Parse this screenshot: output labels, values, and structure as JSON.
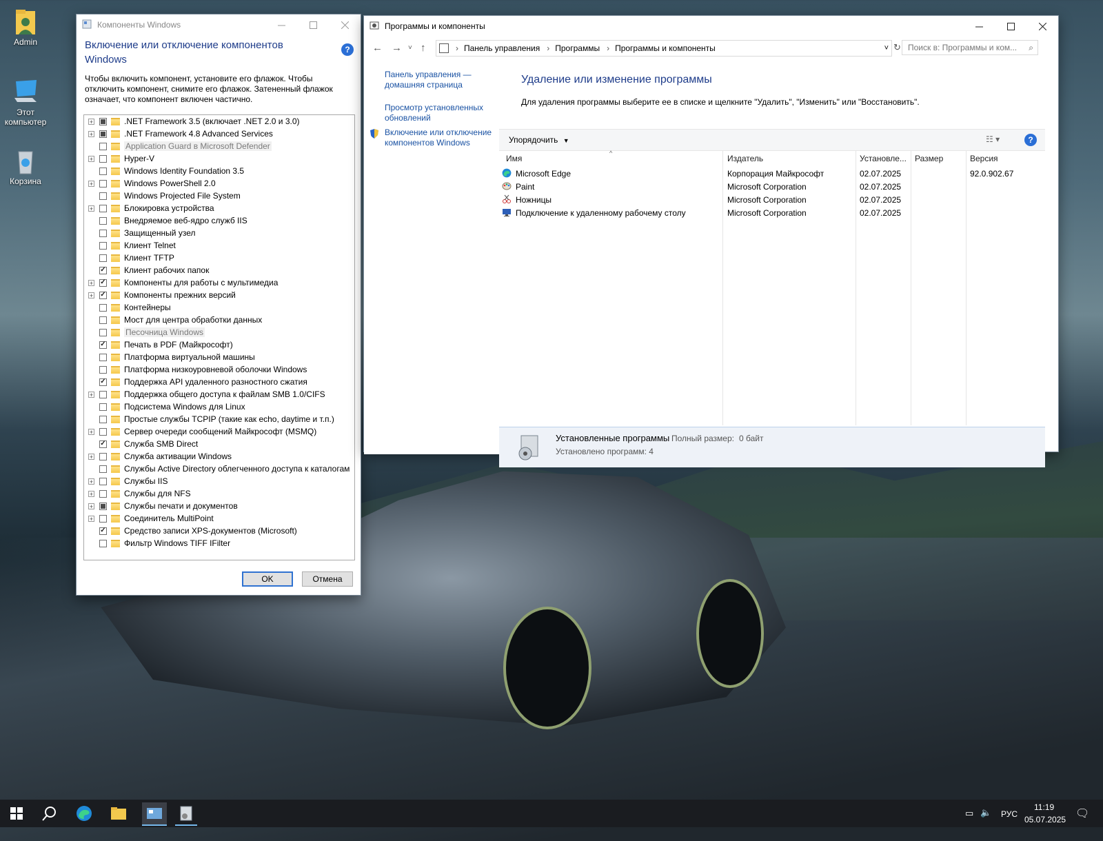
{
  "desktop": {
    "icons": [
      {
        "label": "Admin",
        "icon": "user-folder-icon"
      },
      {
        "label": "Этот компьютер",
        "icon": "computer-icon"
      },
      {
        "label": "Корзина",
        "icon": "recycle-bin-icon"
      }
    ]
  },
  "features_dialog": {
    "title": "Компоненты Windows",
    "heading": "Включение или отключение компонентов Windows",
    "description": "Чтобы включить компонент, установите его флажок. Чтобы отключить компонент, снимите его флажок. Затененный флажок означает, что компонент включен частично.",
    "help_label": "?",
    "items": [
      {
        "label": ".NET Framework 3.5 (включает .NET 2.0 и 3.0)",
        "expandable": true,
        "state": "partial",
        "disabled": false
      },
      {
        "label": ".NET Framework 4.8 Advanced Services",
        "expandable": true,
        "state": "partial",
        "disabled": false
      },
      {
        "label": "Application Guard в Microsoft Defender",
        "expandable": false,
        "state": "unchecked",
        "disabled": true
      },
      {
        "label": "Hyper-V",
        "expandable": true,
        "state": "unchecked",
        "disabled": false
      },
      {
        "label": "Windows Identity Foundation 3.5",
        "expandable": false,
        "state": "unchecked",
        "disabled": false
      },
      {
        "label": "Windows PowerShell 2.0",
        "expandable": true,
        "state": "unchecked",
        "disabled": false
      },
      {
        "label": "Windows Projected File System",
        "expandable": false,
        "state": "unchecked",
        "disabled": false
      },
      {
        "label": "Блокировка устройства",
        "expandable": true,
        "state": "unchecked",
        "disabled": false
      },
      {
        "label": "Внедряемое веб-ядро служб IIS",
        "expandable": false,
        "state": "unchecked",
        "disabled": false
      },
      {
        "label": "Защищенный узел",
        "expandable": false,
        "state": "unchecked",
        "disabled": false
      },
      {
        "label": "Клиент Telnet",
        "expandable": false,
        "state": "unchecked",
        "disabled": false
      },
      {
        "label": "Клиент TFTP",
        "expandable": false,
        "state": "unchecked",
        "disabled": false
      },
      {
        "label": "Клиент рабочих папок",
        "expandable": false,
        "state": "checked",
        "disabled": false
      },
      {
        "label": "Компоненты для работы с мультимедиа",
        "expandable": true,
        "state": "checked",
        "disabled": false
      },
      {
        "label": "Компоненты прежних версий",
        "expandable": true,
        "state": "checked",
        "disabled": false
      },
      {
        "label": "Контейнеры",
        "expandable": false,
        "state": "unchecked",
        "disabled": false
      },
      {
        "label": "Мост для центра обработки данных",
        "expandable": false,
        "state": "unchecked",
        "disabled": false
      },
      {
        "label": "Песочница Windows",
        "expandable": false,
        "state": "unchecked",
        "disabled": true
      },
      {
        "label": "Печать в PDF (Майкрософт)",
        "expandable": false,
        "state": "checked",
        "disabled": false
      },
      {
        "label": "Платформа виртуальной машины",
        "expandable": false,
        "state": "unchecked",
        "disabled": false
      },
      {
        "label": "Платформа низкоуровневой оболочки Windows",
        "expandable": false,
        "state": "unchecked",
        "disabled": false
      },
      {
        "label": "Поддержка API удаленного разностного сжатия",
        "expandable": false,
        "state": "checked",
        "disabled": false
      },
      {
        "label": "Поддержка общего доступа к файлам SMB 1.0/CIFS",
        "expandable": true,
        "state": "unchecked",
        "disabled": false
      },
      {
        "label": "Подсистема Windows для Linux",
        "expandable": false,
        "state": "unchecked",
        "disabled": false
      },
      {
        "label": "Простые службы TCPIP (такие как echo, daytime и т.п.)",
        "expandable": false,
        "state": "unchecked",
        "disabled": false
      },
      {
        "label": "Сервер очереди сообщений Майкрософт (MSMQ)",
        "expandable": true,
        "state": "unchecked",
        "disabled": false
      },
      {
        "label": "Служба SMB Direct",
        "expandable": false,
        "state": "checked",
        "disabled": false
      },
      {
        "label": "Служба активации Windows",
        "expandable": true,
        "state": "unchecked",
        "disabled": false
      },
      {
        "label": "Службы Active Directory облегченного доступа к каталогам",
        "expandable": false,
        "state": "unchecked",
        "disabled": false
      },
      {
        "label": "Службы IIS",
        "expandable": true,
        "state": "unchecked",
        "disabled": false
      },
      {
        "label": "Службы для NFS",
        "expandable": true,
        "state": "unchecked",
        "disabled": false
      },
      {
        "label": "Службы печати и документов",
        "expandable": true,
        "state": "partial",
        "disabled": false
      },
      {
        "label": "Соединитель MultiPoint",
        "expandable": true,
        "state": "unchecked",
        "disabled": false
      },
      {
        "label": "Средство записи XPS-документов (Microsoft)",
        "expandable": false,
        "state": "checked",
        "disabled": false
      },
      {
        "label": "Фильтр Windows TIFF IFilter",
        "expandable": false,
        "state": "unchecked",
        "disabled": false
      }
    ],
    "ok_label": "OK",
    "cancel_label": "Отмена"
  },
  "programs_window": {
    "title": "Программы и компоненты",
    "breadcrumb": [
      "Панель управления",
      "Программы",
      "Программы и компоненты"
    ],
    "search_placeholder": "Поиск в: Программы и ком...",
    "sidebar_links": {
      "home": "Панель управления — домашняя страница",
      "updates": "Просмотр установленных обновлений",
      "features": "Включение или отключение компонентов Windows"
    },
    "heading": "Удаление или изменение программы",
    "description": "Для удаления программы выберите ее в списке и щелкните \"Удалить\", \"Изменить\" или \"Восстановить\".",
    "organize_label": "Упорядочить",
    "columns": {
      "name": "Имя",
      "publisher": "Издатель",
      "installed": "Установле...",
      "size": "Размер",
      "version": "Версия"
    },
    "programs": [
      {
        "name": "Microsoft Edge",
        "publisher": "Корпорация Майкрософт",
        "installed": "02.07.2025",
        "size": "",
        "version": "92.0.902.67",
        "icon": "edge-icon"
      },
      {
        "name": "Paint",
        "publisher": "Microsoft Corporation",
        "installed": "02.07.2025",
        "size": "",
        "version": "",
        "icon": "paint-icon"
      },
      {
        "name": "Ножницы",
        "publisher": "Microsoft Corporation",
        "installed": "02.07.2025",
        "size": "",
        "version": "",
        "icon": "snipping-icon"
      },
      {
        "name": "Подключение к удаленному рабочему столу",
        "publisher": "Microsoft Corporation",
        "installed": "02.07.2025",
        "size": "",
        "version": "",
        "icon": "remote-desktop-icon"
      }
    ],
    "status": {
      "label": "Установленные программы",
      "total_size_label": "Полный размер:",
      "total_size_value": "0 байт",
      "count_text": "Установлено программ: 4"
    }
  },
  "taskbar": {
    "language": "РУС",
    "time": "11:19",
    "date": "05.07.2025"
  },
  "colors": {
    "accent": "#1e3c8a",
    "link": "#1a52a3",
    "taskbar": "#1a1c20"
  }
}
